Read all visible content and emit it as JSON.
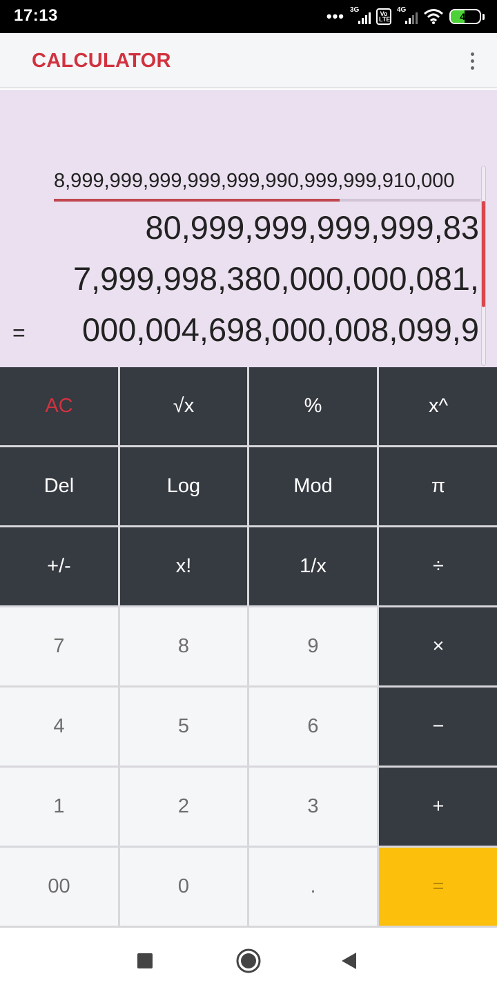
{
  "status_bar": {
    "time": "17:13",
    "signal1_type": "3G",
    "volte_label": "Vo LTE",
    "signal2_type": "4G",
    "battery_level": "48",
    "battery_color": "#4cd137"
  },
  "app_bar": {
    "title": "CALCULATOR",
    "title_color": "#d1323f",
    "menu_icon": "more-vert-icon"
  },
  "display": {
    "expression": "8,999,999,999,999,999,990,999,999,910,000",
    "result_lines": [
      "80,999,999,999,999,83",
      "7,999,998,380,000,000,081,",
      "000,004,698,000,008,099,9"
    ],
    "equals_sign": "=",
    "expression_scroll_fraction": 0.67,
    "background_color": "#ebe0ef"
  },
  "keypad": {
    "rows": [
      [
        {
          "label": "AC",
          "style": "ac"
        },
        {
          "label": "√x",
          "style": "dark"
        },
        {
          "label": "%",
          "style": "dark"
        },
        {
          "label": "x^",
          "style": "dark"
        }
      ],
      [
        {
          "label": "Del",
          "style": "dark"
        },
        {
          "label": "Log",
          "style": "dark"
        },
        {
          "label": "Mod",
          "style": "dark"
        },
        {
          "label": "π",
          "style": "dark"
        }
      ],
      [
        {
          "label": "+/-",
          "style": "dark"
        },
        {
          "label": "x!",
          "style": "dark"
        },
        {
          "label": "1/x",
          "style": "dark"
        },
        {
          "label": "÷",
          "style": "dark"
        }
      ],
      [
        {
          "label": "7",
          "style": "light"
        },
        {
          "label": "8",
          "style": "light"
        },
        {
          "label": "9",
          "style": "light"
        },
        {
          "label": "×",
          "style": "dark"
        }
      ],
      [
        {
          "label": "4",
          "style": "light"
        },
        {
          "label": "5",
          "style": "light"
        },
        {
          "label": "6",
          "style": "light"
        },
        {
          "label": "−",
          "style": "dark"
        }
      ],
      [
        {
          "label": "1",
          "style": "light"
        },
        {
          "label": "2",
          "style": "light"
        },
        {
          "label": "3",
          "style": "light"
        },
        {
          "label": "+",
          "style": "dark"
        }
      ],
      [
        {
          "label": "00",
          "style": "light"
        },
        {
          "label": "0",
          "style": "light"
        },
        {
          "label": ".",
          "style": "light"
        },
        {
          "label": "=",
          "style": "eq"
        }
      ]
    ],
    "colors": {
      "dark": "#363a41",
      "light": "#f5f6f8",
      "accent": "#d1323f",
      "equals": "#fcc00c"
    }
  },
  "nav_bar": {
    "buttons": [
      "recents-square-icon",
      "home-circle-icon",
      "back-triangle-icon"
    ]
  }
}
